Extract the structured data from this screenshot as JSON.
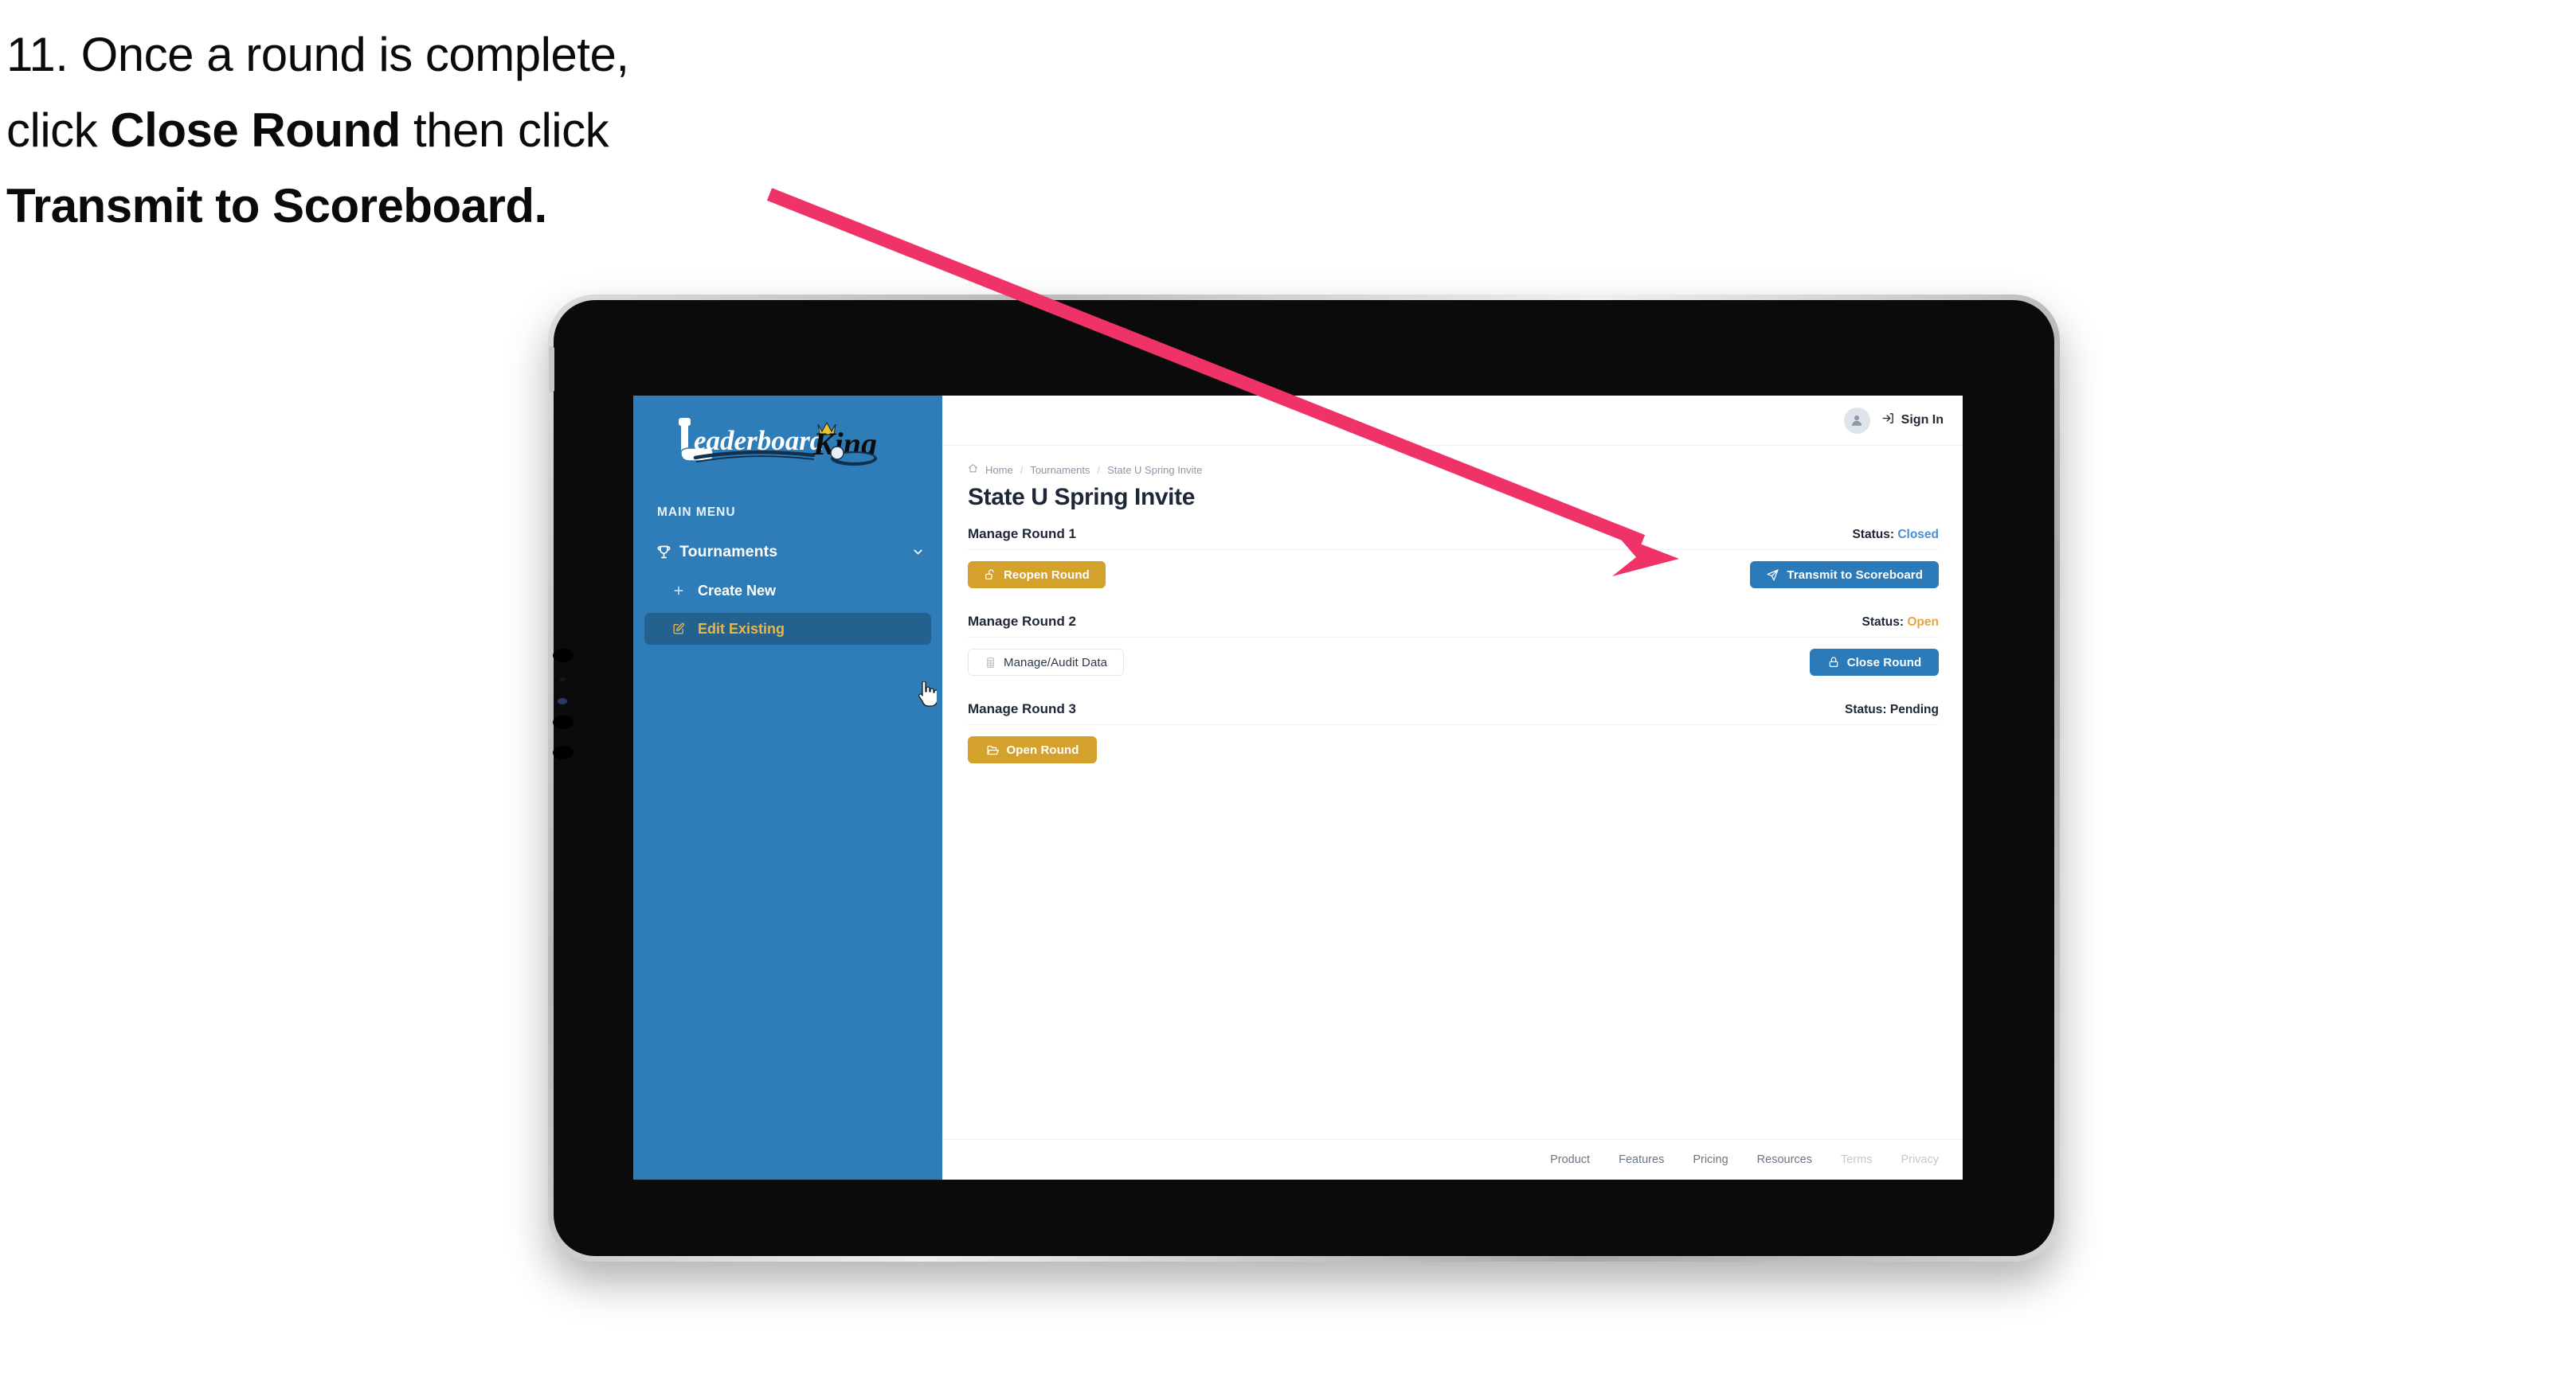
{
  "caption": {
    "line1": "11. Once a round is complete,",
    "line2_pre": "click ",
    "line2_bold": "Close Round",
    "line2_post": " then click",
    "line3_bold": "Transmit to Scoreboard."
  },
  "annotation": {
    "arrow_color": "#ef3368",
    "points_to": "transmit-to-scoreboard-button"
  },
  "sidebar": {
    "logo_text_1": "Leaderboard",
    "logo_text_2": "King",
    "menu_heading": "MAIN MENU",
    "nav": {
      "label": "Tournaments",
      "icon": "trophy-icon",
      "chevron": "chevron-down-icon"
    },
    "sub_items": [
      {
        "label": "Create New",
        "icon": "plus-icon",
        "active": false
      },
      {
        "label": "Edit Existing",
        "icon": "edit-icon",
        "active": true
      }
    ],
    "bg_color": "#2e7cb8",
    "active_bg_color": "#23628f",
    "active_text_color": "#e8b64c"
  },
  "topbar": {
    "avatar_icon": "user-avatar-icon",
    "signin_icon": "sign-in-icon",
    "signin_label": "Sign In"
  },
  "breadcrumb": {
    "home_icon": "home-icon",
    "items": [
      "Home",
      "Tournaments",
      "State U Spring Invite"
    ],
    "separator": "/"
  },
  "page_title": "State U Spring Invite",
  "rounds": [
    {
      "title": "Manage Round 1",
      "status_label": "Status:",
      "status_value": "Closed",
      "status_color": "#4a8fd4",
      "left_button": {
        "label": "Reopen Round",
        "icon": "unlock-icon",
        "style": "gold"
      },
      "right_button": {
        "label": "Transmit to Scoreboard",
        "icon": "send-icon",
        "style": "blue"
      }
    },
    {
      "title": "Manage Round 2",
      "status_label": "Status:",
      "status_value": "Open",
      "status_color": "#e8a33d",
      "left_button": {
        "label": "Manage/Audit Data",
        "icon": "table-grid-icon",
        "style": "ghost"
      },
      "right_button": {
        "label": "Close Round",
        "icon": "lock-icon",
        "style": "blue"
      }
    },
    {
      "title": "Manage Round 3",
      "status_label": "Status:",
      "status_value": "Pending",
      "status_color": "#1d2737",
      "left_button": {
        "label": "Open Round",
        "icon": "open-folder-icon",
        "style": "gold"
      },
      "right_button": null
    }
  ],
  "footer": {
    "links": [
      {
        "label": "Product",
        "muted": false
      },
      {
        "label": "Features",
        "muted": false
      },
      {
        "label": "Pricing",
        "muted": false
      },
      {
        "label": "Resources",
        "muted": false
      },
      {
        "label": "Terms",
        "muted": true
      },
      {
        "label": "Privacy",
        "muted": true
      }
    ]
  },
  "colors": {
    "gold": "#d4a12c",
    "blue": "#2b7ab9",
    "sidebar_blue": "#2e7cb8",
    "navy_text": "#1d2737",
    "arrow_pink": "#ef3368"
  }
}
